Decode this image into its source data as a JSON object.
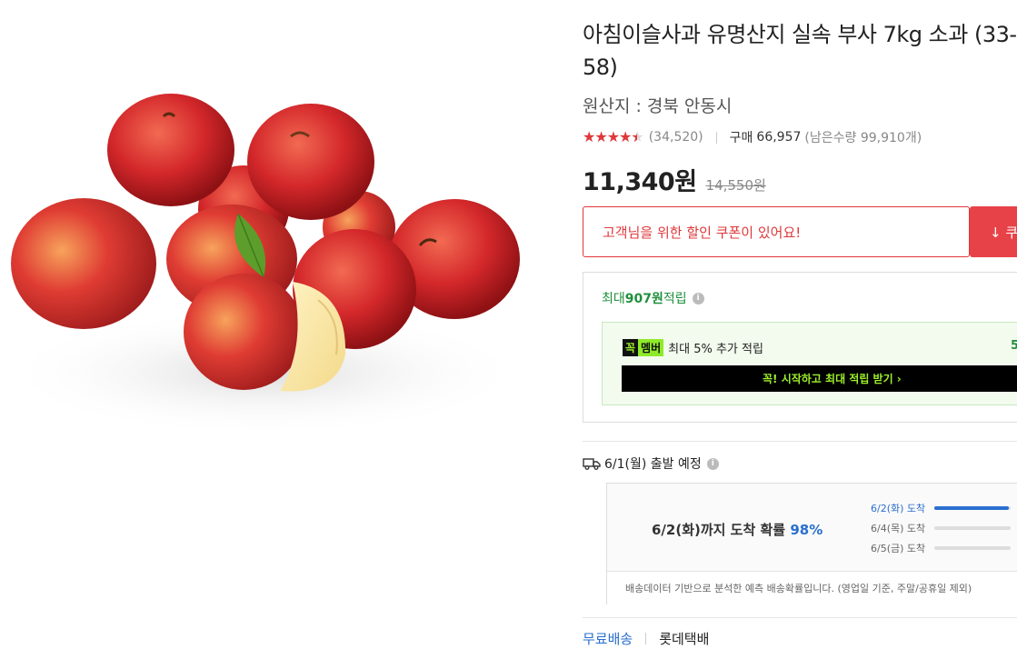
{
  "product": {
    "title": "아침이슬사과 유명산지 실속 부사 7kg 소과 (33-58)",
    "origin": "원산지 : 경북 안동시"
  },
  "rating": {
    "stars": "★★★★★",
    "score_fraction": 0.9,
    "review_count": "(34,520)",
    "buy_label": "구매",
    "buy_count": "66,957",
    "stock_text": "(남은수량 99,910개)"
  },
  "price": {
    "current": "11,340원",
    "original": "14,550원"
  },
  "coupon": {
    "message": "고객님을 위한 할인 쿠폰이 있어요!",
    "button_label": "↓ 쿠폰받기"
  },
  "reward": {
    "max_prefix": "최대 ",
    "max_amount": "907원",
    "max_suffix": " 적립",
    "info_icon": "i",
    "member_badge_1": "꼭",
    "member_badge_2": "멤버",
    "member_text": "최대 5% 추가 적립",
    "member_rate": "5%",
    "member_cta": "꼭! 시작하고 최대 적립 받기 ›"
  },
  "shipping": {
    "departure": "6/1(월) 출발 예정",
    "info_icon": "i",
    "arrival_main": "6/2(화)까지 도착 확률 ",
    "arrival_pct": "98%",
    "rows": [
      {
        "label": "6/2(화) 도착",
        "fill": 0.98
      },
      {
        "label": "6/4(목) 도착",
        "fill": 0.0
      },
      {
        "label": "6/5(금) 도착",
        "fill": 0.0
      }
    ],
    "note": "배송데이터 기반으로 분석한 예측 배송확률입니다. (영업일 기준, 주말/공휴일 제외)"
  },
  "delivery": {
    "free": "무료배송",
    "courier": "롯데택배"
  },
  "colors": {
    "accent_red": "#e0383a",
    "reward_green": "#1f8f3c",
    "member_lime": "#8fea2a",
    "ship_blue": "#2a6fcf"
  }
}
